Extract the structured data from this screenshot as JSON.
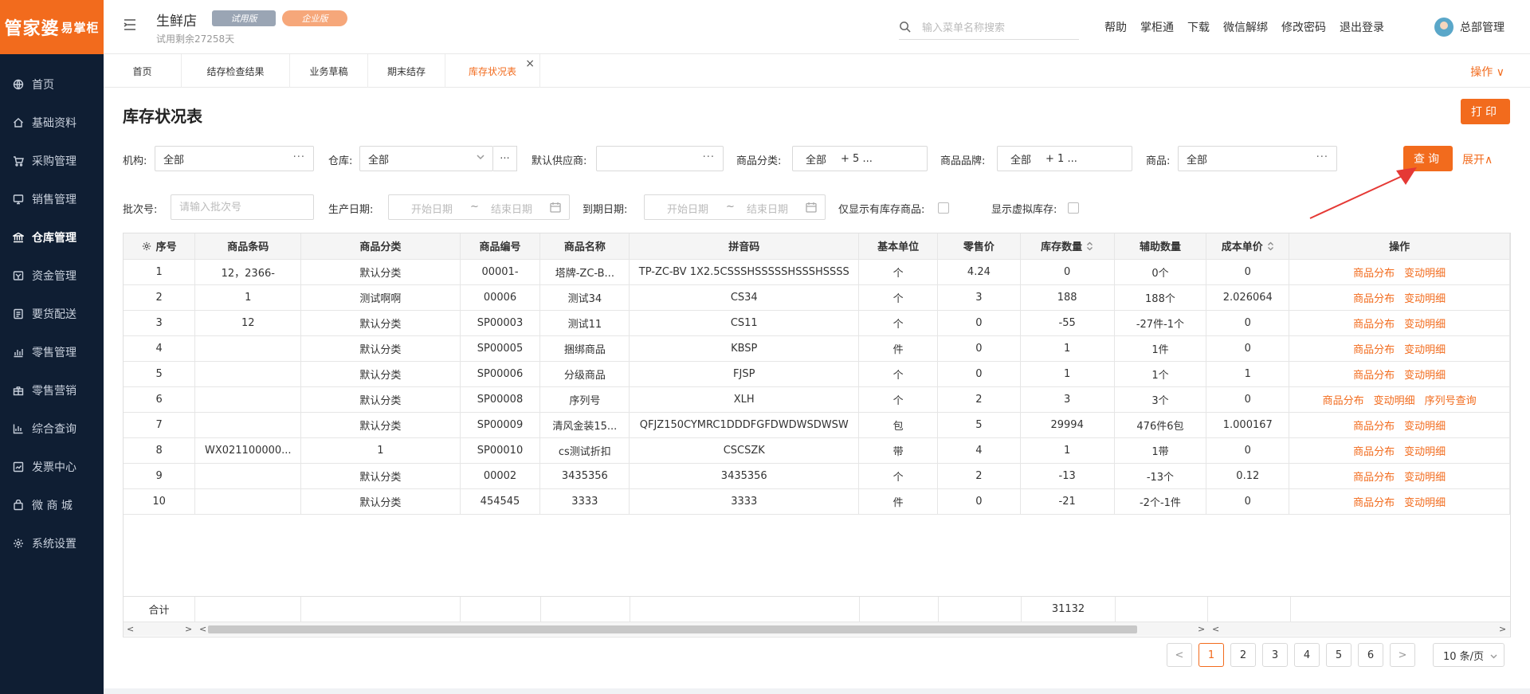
{
  "logo": {
    "main": "管家婆",
    "sub": "易掌柜"
  },
  "sidebar": {
    "items": [
      {
        "label": "首页",
        "icon": "globe-icon"
      },
      {
        "label": "基础资料",
        "icon": "home-icon"
      },
      {
        "label": "采购管理",
        "icon": "cart-icon"
      },
      {
        "label": "销售管理",
        "icon": "monitor-icon"
      },
      {
        "label": "仓库管理",
        "icon": "bank-icon",
        "active": true
      },
      {
        "label": "资金管理",
        "icon": "wallet-icon"
      },
      {
        "label": "要货配送",
        "icon": "list-icon"
      },
      {
        "label": "零售管理",
        "icon": "chart-icon"
      },
      {
        "label": "零售营销",
        "icon": "gift-icon"
      },
      {
        "label": "综合查询",
        "icon": "bar-chart-icon"
      },
      {
        "label": "发票中心",
        "icon": "invoice-icon"
      },
      {
        "label": "微 商 城",
        "icon": "bag-icon"
      },
      {
        "label": "系统设置",
        "icon": "gear-icon"
      }
    ]
  },
  "header": {
    "shop_name": "生鲜店",
    "badge_trial": "试用版",
    "badge_pro": "企业版",
    "trial_info": "试用剩余27258天",
    "search_placeholder": "输入菜单名称搜索",
    "links": [
      "帮助",
      "掌柜通",
      "下载",
      "微信解绑",
      "修改密码",
      "退出登录"
    ],
    "user_name": "总部管理"
  },
  "tabs": {
    "items": [
      "首页",
      "结存检查结果",
      "业务草稿",
      "期末结存",
      "库存状况表"
    ],
    "active_index": 4,
    "ops_label": "操作 ∨"
  },
  "page": {
    "title": "库存状况表",
    "print_label": "打印",
    "query_label": "查询",
    "expand_label": "展开∧"
  },
  "filters": {
    "org_label": "机构:",
    "org_value": "全部",
    "warehouse_label": "仓库:",
    "warehouse_value": "全部",
    "supplier_label": "默认供应商:",
    "supplier_value": "",
    "category_label": "商品分类:",
    "category_value": "全部",
    "category_extra": "+ 5 ...",
    "brand_label": "商品品牌:",
    "brand_value": "全部",
    "brand_extra": "+ 1 ...",
    "product_label": "商品:",
    "product_value": "全部",
    "batch_label": "批次号:",
    "batch_placeholder": "请输入批次号",
    "prod_date_label": "生产日期:",
    "expire_date_label": "到期日期:",
    "date_start": "开始日期",
    "date_end": "结束日期",
    "date_sep": "~",
    "only_stock_label": "仅显示有库存商品:",
    "virtual_stock_label": "显示虚拟库存:",
    "dots": "···"
  },
  "table": {
    "headers": [
      "序号",
      "商品条码",
      "商品分类",
      "商品编号",
      "商品名称",
      "拼音码",
      "基本单位",
      "零售价",
      "库存数量",
      "辅助数量",
      "成本单价",
      "操作"
    ],
    "rows": [
      {
        "cells": [
          "1",
          "12，2366-",
          "默认分类",
          "00001-",
          "塔牌-ZC-B...",
          "TP-ZC-BV 1X2.5CSSSHSSSSSHSSSHSSSS",
          "个",
          "4.24",
          "0",
          "0个",
          "0"
        ],
        "ops": [
          "商品分布",
          "变动明细"
        ]
      },
      {
        "cells": [
          "2",
          "1",
          "测试啊啊",
          "00006",
          "测试34",
          "CS34",
          "个",
          "3",
          "188",
          "188个",
          "2.026064"
        ],
        "ops": [
          "商品分布",
          "变动明细"
        ]
      },
      {
        "cells": [
          "3",
          "12",
          "默认分类",
          "SP00003",
          "测试11",
          "CS11",
          "个",
          "0",
          "-55",
          "-27件-1个",
          "0"
        ],
        "ops": [
          "商品分布",
          "变动明细"
        ]
      },
      {
        "cells": [
          "4",
          "",
          "默认分类",
          "SP00005",
          "捆绑商品",
          "KBSP",
          "件",
          "0",
          "1",
          "1件",
          "0"
        ],
        "ops": [
          "商品分布",
          "变动明细"
        ]
      },
      {
        "cells": [
          "5",
          "",
          "默认分类",
          "SP00006",
          "分级商品",
          "FJSP",
          "个",
          "0",
          "1",
          "1个",
          "1"
        ],
        "ops": [
          "商品分布",
          "变动明细"
        ]
      },
      {
        "cells": [
          "6",
          "",
          "默认分类",
          "SP00008",
          "序列号",
          "XLH",
          "个",
          "2",
          "3",
          "3个",
          "0"
        ],
        "ops": [
          "商品分布",
          "变动明细",
          "序列号查询"
        ]
      },
      {
        "cells": [
          "7",
          "",
          "默认分类",
          "SP00009",
          "清风金装15...",
          "QFJZ150CYMRC1DDDFGFDWDWSDWSW",
          "包",
          "5",
          "29994",
          "476件6包",
          "1.000167"
        ],
        "ops": [
          "商品分布",
          "变动明细"
        ]
      },
      {
        "cells": [
          "8",
          "WX021100000...",
          "1",
          "SP00010",
          "cs测试折扣",
          "CSCSZK",
          "带",
          "4",
          "1",
          "1带",
          "0"
        ],
        "ops": [
          "商品分布",
          "变动明细"
        ]
      },
      {
        "cells": [
          "9",
          "",
          "默认分类",
          "00002",
          "3435356",
          "3435356",
          "个",
          "2",
          "-13",
          "-13个",
          "0.12"
        ],
        "ops": [
          "商品分布",
          "变动明细"
        ]
      },
      {
        "cells": [
          "10",
          "",
          "默认分类",
          "454545",
          "3333",
          "3333",
          "件",
          "0",
          "-21",
          "-2个-1件",
          "0"
        ],
        "ops": [
          "商品分布",
          "变动明细"
        ]
      }
    ],
    "sum_label": "合计",
    "sum_stock": "31132"
  },
  "pager": {
    "prev": "<",
    "next": ">",
    "pages": [
      "1",
      "2",
      "3",
      "4",
      "5",
      "6"
    ],
    "current": "1",
    "page_size": "10 条/页"
  },
  "colors": {
    "accent": "#f26b1d",
    "sidebar_bg": "#0f1e33"
  }
}
